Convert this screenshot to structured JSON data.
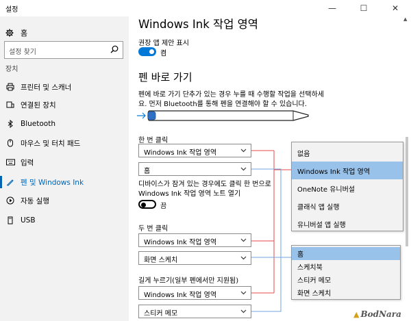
{
  "app_title": "설정",
  "window_controls": {
    "minimize": "—",
    "maximize": "☐",
    "close": "✕"
  },
  "sidebar": {
    "home": "홈",
    "search_placeholder": "설정 찾기",
    "section": "장치",
    "items": [
      {
        "label": "프린터 및 스캐너",
        "icon": "printer-icon"
      },
      {
        "label": "연결된 장치",
        "icon": "devices-icon"
      },
      {
        "label": "Bluetooth",
        "icon": "bluetooth-icon"
      },
      {
        "label": "마우스 및 터치 패드",
        "icon": "mouse-icon"
      },
      {
        "label": "입력",
        "icon": "keyboard-icon"
      },
      {
        "label": "펜 및 Windows Ink",
        "icon": "pen-icon",
        "active": true
      },
      {
        "label": "자동 실행",
        "icon": "autoplay-icon"
      },
      {
        "label": "USB",
        "icon": "usb-icon"
      }
    ]
  },
  "main": {
    "title": "Windows Ink 작업 영역",
    "suggest_label": "권장 앱 제안 표시",
    "suggest_state": "켬",
    "shortcuts_title": "펜 바로 가기",
    "description": "펜에 바로 가기 단추가 있는 경우 누를 때 수행할 작업을 선택하세요. 먼저 Bluetooth를 통해 펜을 연결해야 할 수 있습니다.",
    "single_click": {
      "label": "한 번 클릭",
      "action": "Windows Ink 작업 영역",
      "app": "홈"
    },
    "lock_desc": "디바이스가 잠겨 있는 경우에도 클릭 한 번으로 Windows Ink 작업 영역 노트 열기",
    "lock_state": "끔",
    "double_click": {
      "label": "두 번 클릭",
      "action": "Windows Ink 작업 영역",
      "app": "화면 스케치"
    },
    "long_press": {
      "label": "길게 누르기(일부 펜에서만 지원됨)",
      "action": "Windows Ink 작업 영역",
      "app": "스티커 메모"
    }
  },
  "popup_actions": {
    "items": [
      "없음",
      "Windows Ink 작업 영역",
      "OneNote 유니버설",
      "클래식 앱 실행",
      "유니버설 앱 실행"
    ],
    "selected": 1
  },
  "popup_apps": {
    "items": [
      "홈",
      "스케치북",
      "스티커 메모",
      "화면 스케치"
    ],
    "selected": 0
  },
  "watermark": "BodNara",
  "colors": {
    "accent": "#0078d7",
    "active_text": "#0063b1",
    "red_line": "#e8474a",
    "blue_line": "#6fa3e0",
    "highlight": "#99c2ea"
  }
}
